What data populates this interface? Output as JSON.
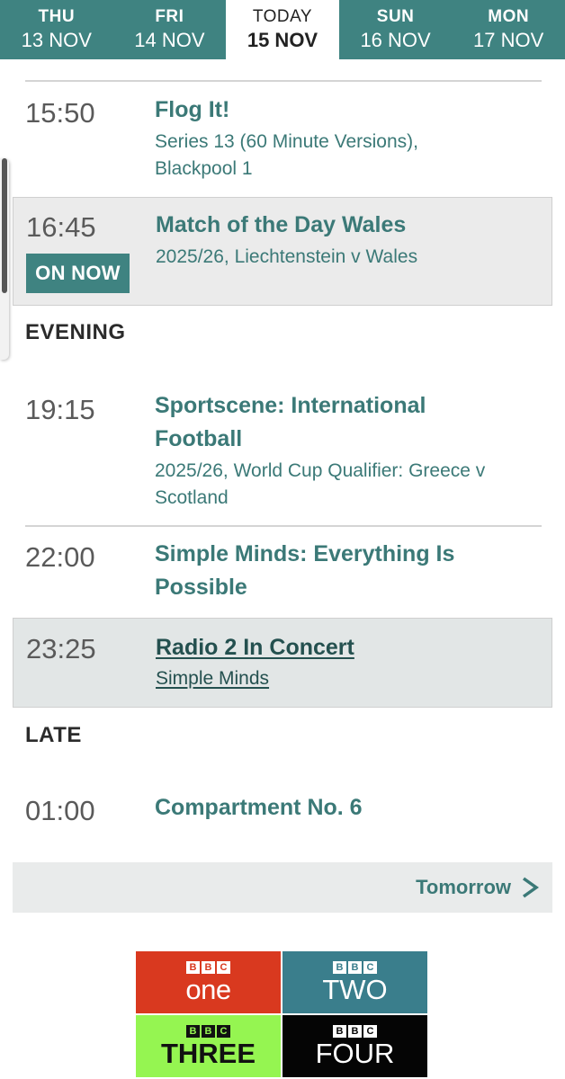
{
  "day_tabs": [
    {
      "day": "THU",
      "date": "13 NOV"
    },
    {
      "day": "FRI",
      "date": "14 NOV"
    },
    {
      "day": "TODAY",
      "date": "15 NOV"
    },
    {
      "day": "SUN",
      "date": "16 NOV"
    },
    {
      "day": "MON",
      "date": "17 NOV"
    }
  ],
  "programmes": [
    {
      "time": "15:50",
      "title": "Flog It!",
      "subtitle_line1": "Series 13 (60 Minute Versions),",
      "subtitle_line2": "Blackpool 1"
    },
    {
      "time": "16:45",
      "title": "Match of the Day Wales",
      "subtitle": "2025/26, Liechtenstein v Wales",
      "badge": "ON NOW"
    },
    {
      "time": "19:15",
      "title_line1": "Sportscene: International",
      "title_line2": "Football",
      "subtitle_line1": "2025/26, World Cup Qualifier: Greece v",
      "subtitle_line2": "Scotland"
    },
    {
      "time": "22:00",
      "title_line1": "Simple Minds: Everything Is",
      "title_line2": "Possible"
    },
    {
      "time": "23:25",
      "title": "Radio 2 In Concert",
      "subtitle": "Simple Minds"
    },
    {
      "time": "01:00",
      "title": "Compartment No. 6"
    }
  ],
  "sections": {
    "evening": "EVENING",
    "late": "LATE"
  },
  "tomorrow": {
    "label": "Tomorrow",
    "icon": "chevron-right-icon"
  },
  "channels": [
    {
      "brand": "BBC",
      "name": "one",
      "color": "#d9391f"
    },
    {
      "brand": "BBC",
      "name": "TWO",
      "color": "#3a7e8c"
    },
    {
      "brand": "BBC",
      "name": "THREE",
      "color": "#95f551"
    },
    {
      "brand": "BBC",
      "name": "FOUR",
      "color": "#050505"
    }
  ],
  "colors": {
    "accent": "#3f8381",
    "link": "#3b7977",
    "highlight_bg": "#ebebeb"
  }
}
